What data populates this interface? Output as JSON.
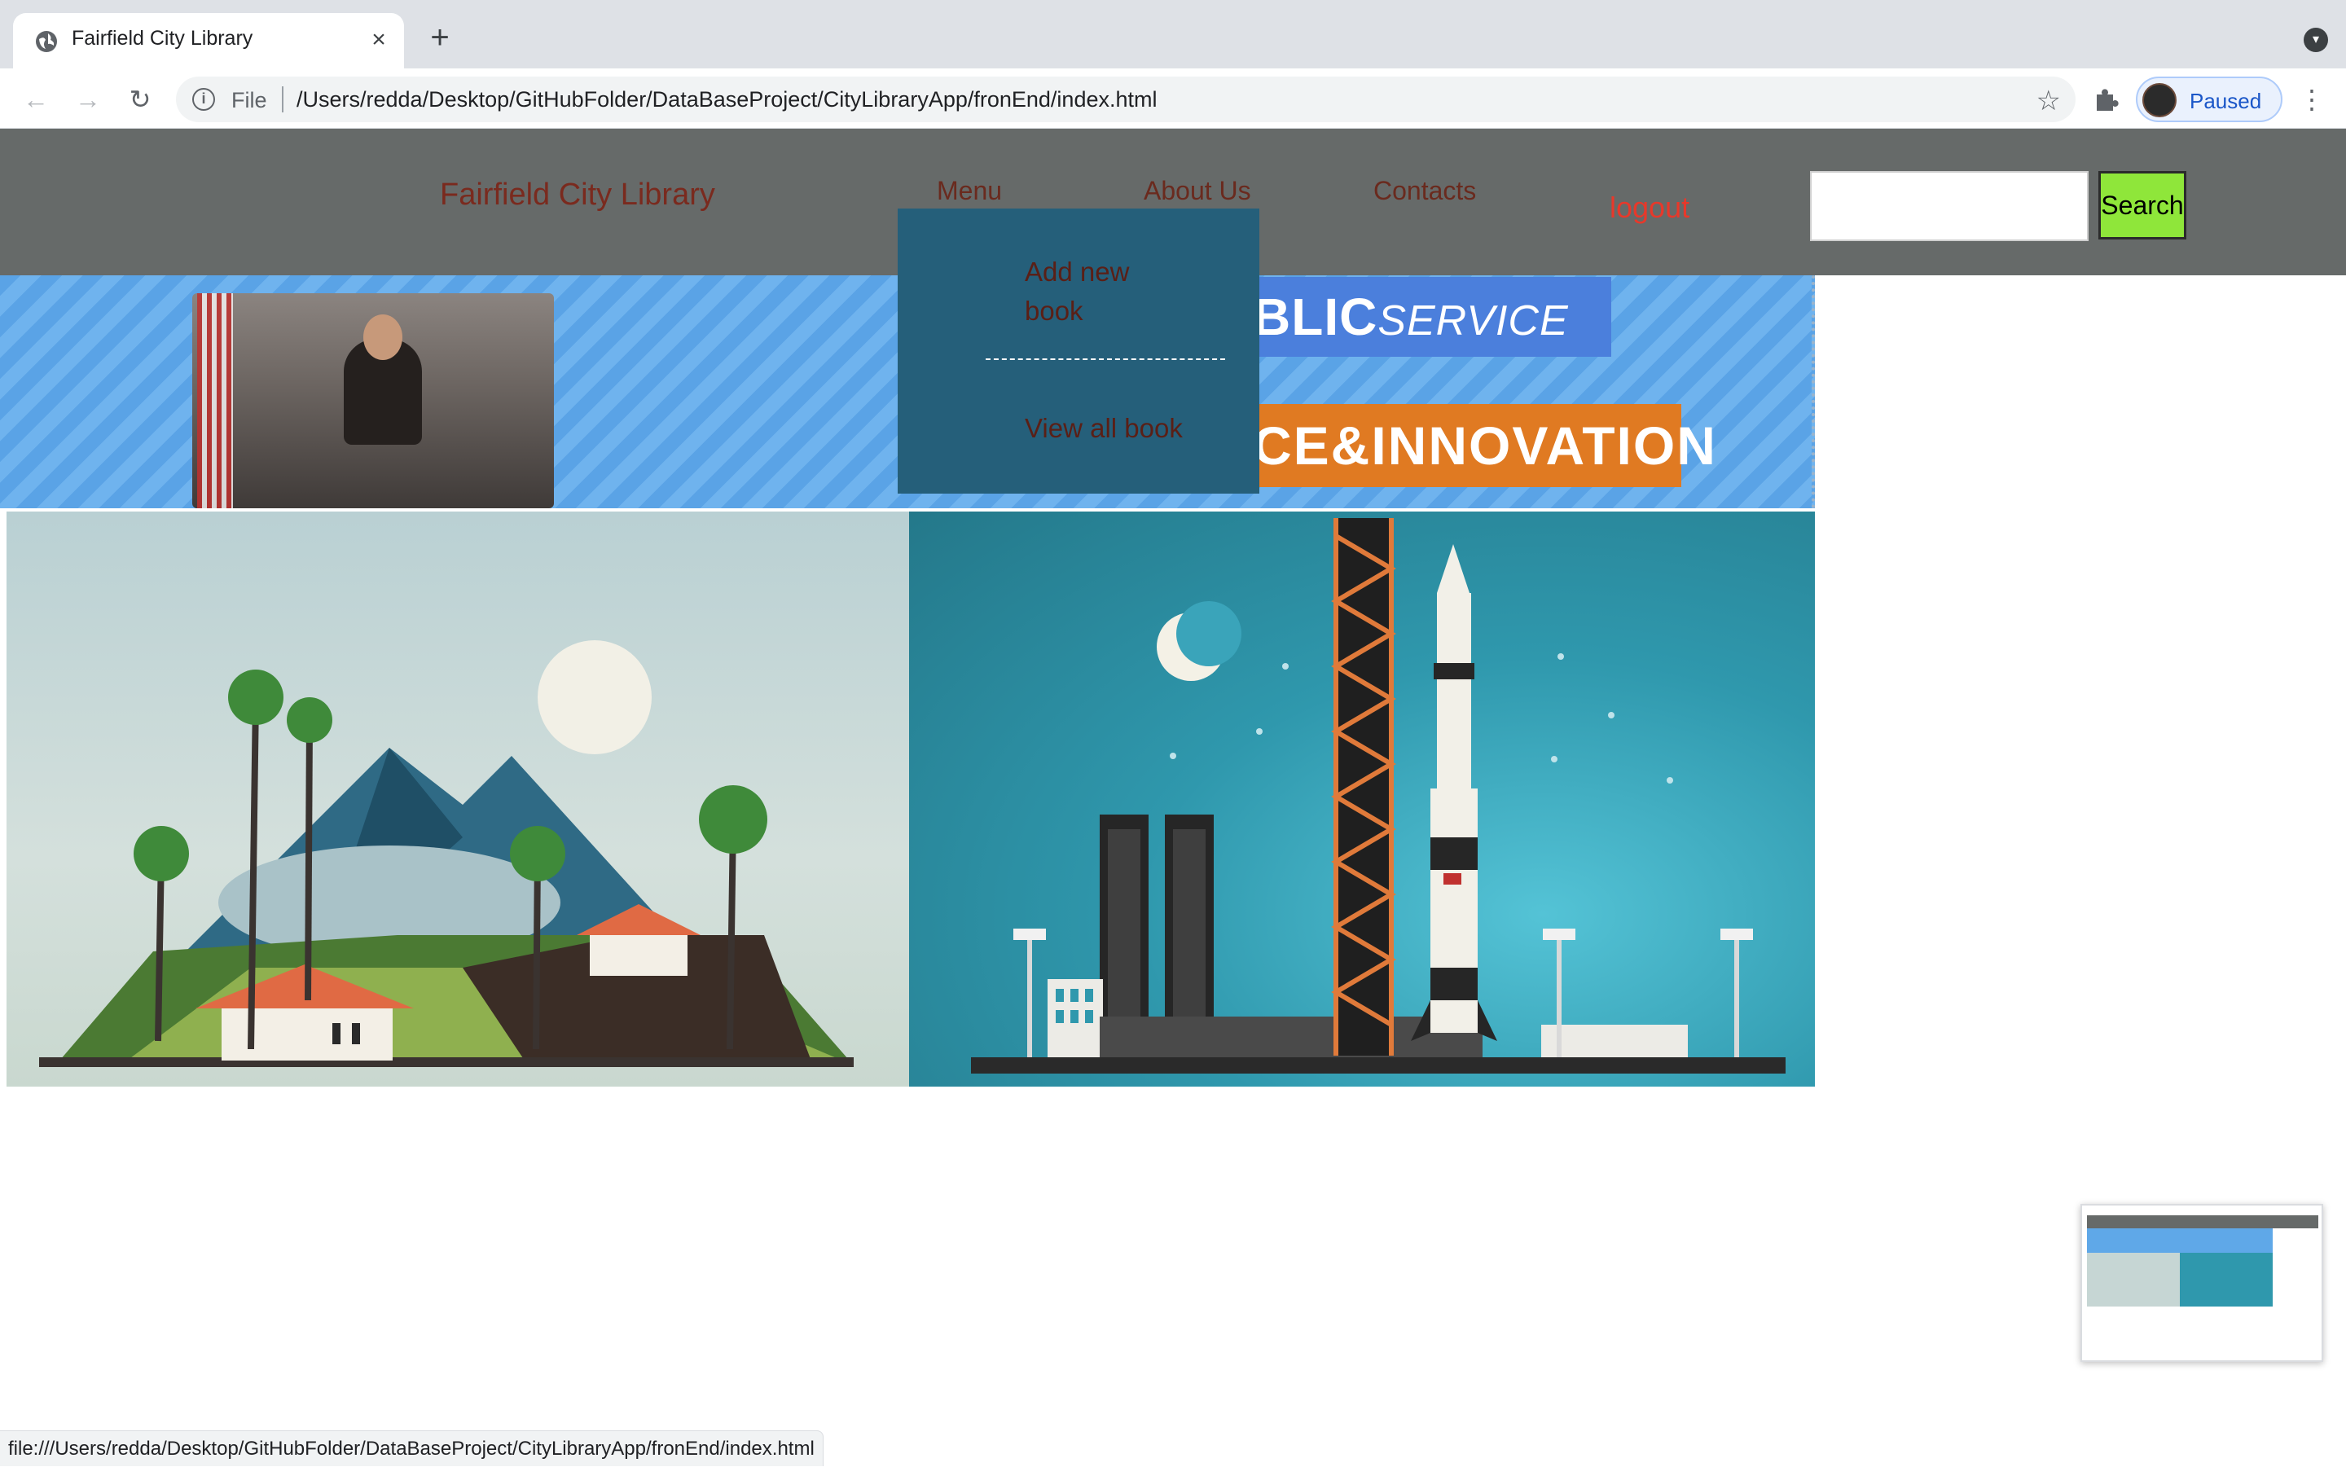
{
  "browser": {
    "tab_title": "Fairfield City Library",
    "tab_close": "×",
    "new_tab": "+",
    "scheme_label": "File",
    "url": "/Users/redda/Desktop/GitHubFolder/DataBaseProject/CityLibraryApp/fronEnd/index.html",
    "profile_label": "Paused",
    "status_url": "file:///Users/redda/Desktop/GitHubFolder/DataBaseProject/CityLibraryApp/fronEnd/index.html"
  },
  "site": {
    "brand": "Fairfield City Library",
    "nav": {
      "menu": "Menu",
      "about": "About Us",
      "contacts": "Contacts",
      "logout": "logout"
    },
    "search": {
      "value": "",
      "button_label": "Search"
    },
    "dropdown": {
      "add_book": "Add new book",
      "view_all": "View all book"
    },
    "banner": {
      "public_service_a": "BLIC",
      "public_service_b": "SERVICE",
      "innovation": "CE&INNOVATION"
    }
  },
  "colors": {
    "header_bg": "#666a69",
    "dropdown_bg": "#255f7a",
    "search_button": "#8fe63a",
    "logout": "#e8382a",
    "link_text": "#6a2a1e"
  }
}
